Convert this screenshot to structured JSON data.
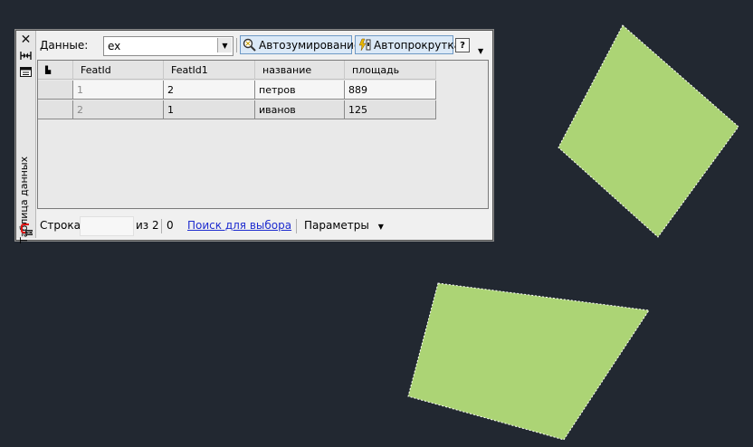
{
  "palette": {
    "title_vertical": "Таблица данных",
    "toolbar": {
      "data_label": "Данные:",
      "data_value": "ex",
      "autozoom_label": "Автозумирование",
      "autoscroll_label": "Автопрокрутка",
      "help_label": "?"
    },
    "table": {
      "columns": [
        "",
        "FeatId",
        "FeatId1",
        "название",
        "площадь"
      ],
      "rows": [
        {
          "featid": "1",
          "featid1": "2",
          "name": "петров",
          "area": "889"
        },
        {
          "featid": "2",
          "featid1": "1",
          "name": "иванов",
          "area": "125"
        }
      ]
    },
    "status": {
      "row_label": "Строка",
      "row_value": "",
      "of_label": "из 2",
      "count": "0",
      "select_link": "Поиск для выбора",
      "params_label": "Параметры"
    }
  },
  "colors": {
    "background": "#222831",
    "polygon_fill": "#acd475",
    "link": "#1e2ccf"
  }
}
